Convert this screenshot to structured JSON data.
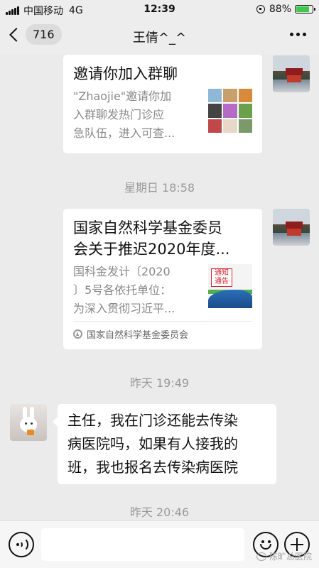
{
  "status_bar": {
    "carrier": "中国移动",
    "network": "4G",
    "time": "12:39",
    "battery": "88%",
    "battery_level": 0.88
  },
  "nav": {
    "unread_count": "716",
    "title": "王倩^_^"
  },
  "messages": {
    "invite": {
      "title": "邀请你加入群聊",
      "desc_line1": "\"Zhaojie\"邀请你加",
      "desc_line2": "入群聊发热门诊应",
      "desc_line3": "急队伍，进入可查..."
    },
    "timestamp1": "星期日 18:58",
    "article": {
      "title_line1": "国家自然科学基金委员",
      "title_line2": "会关于推迟2020年度...",
      "desc_line1": "国科金发计〔2020",
      "desc_line2": "〕5号各依托单位：",
      "desc_line3": "为深入贯彻习近平...",
      "thumb_text": "通知\n通告",
      "source": "国家自然科学基金委员会"
    },
    "timestamp2": "昨天 19:49",
    "text": {
      "line1": "主任，我在门诊还能去传染",
      "line2": "病医院吗，如果有人接我的",
      "line3": "班，我也报名去传染病医院"
    },
    "timestamp3": "昨天 20:46"
  },
  "input_bar": {
    "placeholder": ""
  },
  "watermark": "陈旷总医院",
  "colors": {
    "background": "#ebebeb",
    "battery_fill": "#3ec84d",
    "timestamp": "#9a9a9a",
    "desc": "#888888"
  },
  "icons": [
    "signal-bars-icon",
    "lock-rotation-icon",
    "battery-icon",
    "chevron-left-icon",
    "more-dots-icon",
    "voice-icon",
    "emoji-icon",
    "plus-icon",
    "compass-icon"
  ]
}
